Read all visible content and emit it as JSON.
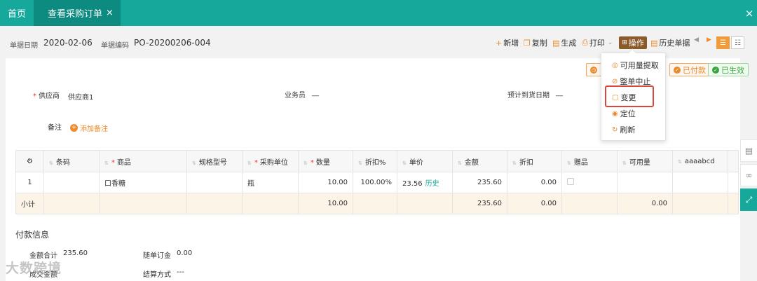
{
  "tabs": [
    {
      "label": "首页"
    },
    {
      "label": "查看采购订单",
      "close": "×"
    }
  ],
  "window_close": "×",
  "header": {
    "date_label": "单据日期",
    "date_value": "2020-02-06",
    "code_label": "单据编码",
    "code_value": "PO-20200206-004"
  },
  "toolbar": {
    "new": "新增",
    "copy": "复制",
    "generate": "生成",
    "print": "打印",
    "operate": "操作",
    "history": "历史单据"
  },
  "status_badges": [
    "已付款",
    "已生效"
  ],
  "form": {
    "supplier_label": "供应商",
    "supplier_value": "供应商1",
    "salesman_label": "业务员",
    "salesman_value": "__",
    "delivery_label": "预计到货日期",
    "delivery_value": "__",
    "note_label": "备注",
    "add_note": "添加备注"
  },
  "grid": {
    "headers": [
      "条码",
      "商品",
      "规格型号",
      "采购单位",
      "数量",
      "折扣%",
      "单价",
      "金额",
      "折扣",
      "赠品",
      "可用量",
      "aaaabcd"
    ],
    "rows": [
      {
        "idx": "1",
        "barcode": "",
        "product": "口香糖",
        "spec": "",
        "unit": "瓶",
        "qty": "10.00",
        "discount_pct": "100.00%",
        "price": "23.56",
        "history": "历史",
        "amount": "235.60",
        "discount": "0.00",
        "available": "",
        "custom": ""
      }
    ],
    "subtotal": {
      "label": "小计",
      "qty": "10.00",
      "amount": "235.60",
      "discount": "0.00",
      "available": "0.00"
    }
  },
  "payment": {
    "title": "付款信息",
    "total_label": "金额合计",
    "total_value": "235.60",
    "deposit_label": "随单订金",
    "deposit_value": "0.00",
    "deal_label": "成交金额",
    "settle_label": "结算方式",
    "settle_value": "---"
  },
  "dropdown": [
    "可用量提取",
    "整单中止",
    "变更",
    "定位",
    "刷新"
  ],
  "watermark": "大数跨境",
  "colors": {
    "brand": "#16a99b",
    "accent": "#e88a2b",
    "highlight": "#d9473a",
    "success": "#3aa23f"
  }
}
